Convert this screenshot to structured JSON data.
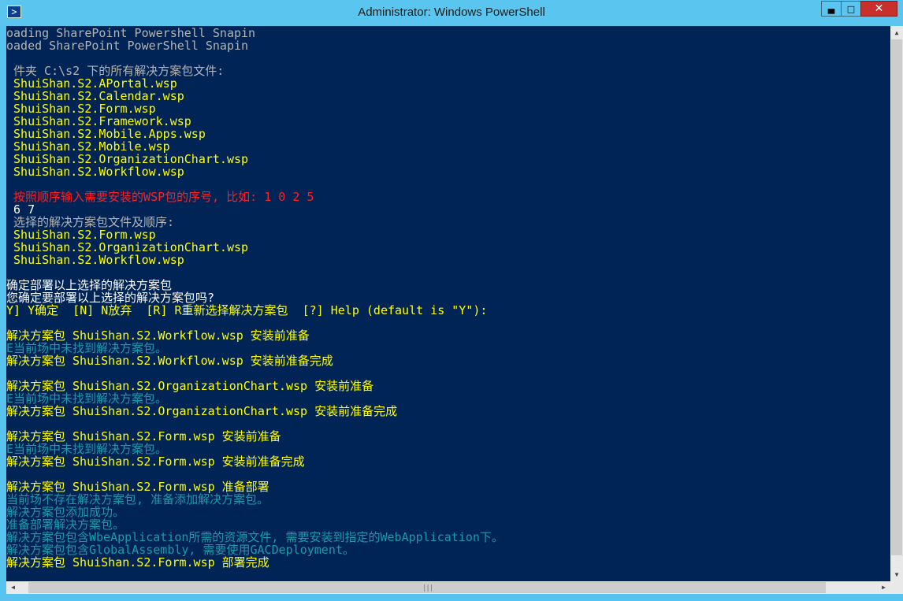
{
  "window": {
    "title": "Administrator: Windows PowerShell",
    "app_icon": "powershell-icon"
  },
  "buttons": {
    "minimize": "minimize-icon",
    "maximize": "maximize-icon",
    "close": "close-icon"
  },
  "colors": {
    "console_bg": "#012456",
    "titlebar": "#5ac6ef",
    "gray": "#b4b4b4",
    "yellow": "#ffff00",
    "red": "#ff2020",
    "white": "#ffffff",
    "cyan": "#1a9aac"
  },
  "console": {
    "lines": [
      {
        "text": "oading SharePoint Powershell Snapin",
        "color": "#b4b4b4"
      },
      {
        "text": "oaded SharePoint PowerShell Snapin",
        "color": "#b4b4b4"
      },
      {
        "text": "",
        "color": "#b4b4b4"
      },
      {
        "text": " 件夹 C:\\s2 下的所有解决方案包文件:",
        "color": "#b4b4b4"
      },
      {
        "text": " ShuiShan.S2.APortal.wsp",
        "color": "#ffff00"
      },
      {
        "text": " ShuiShan.S2.Calendar.wsp",
        "color": "#ffff00"
      },
      {
        "text": " ShuiShan.S2.Form.wsp",
        "color": "#ffff00"
      },
      {
        "text": " ShuiShan.S2.Framework.wsp",
        "color": "#ffff00"
      },
      {
        "text": " ShuiShan.S2.Mobile.Apps.wsp",
        "color": "#ffff00"
      },
      {
        "text": " ShuiShan.S2.Mobile.wsp",
        "color": "#ffff00"
      },
      {
        "text": " ShuiShan.S2.OrganizationChart.wsp",
        "color": "#ffff00"
      },
      {
        "text": " ShuiShan.S2.Workflow.wsp",
        "color": "#ffff00"
      },
      {
        "text": "",
        "color": "#b4b4b4"
      },
      {
        "text": " 按照顺序输入需要安装的WSP包的序号, 比如: 1 0 2 5",
        "color": "#ff2020"
      },
      {
        "text": " 6 7",
        "color": "#ffffff"
      },
      {
        "text": " 选择的解决方案包文件及顺序:",
        "color": "#b4b4b4"
      },
      {
        "text": " ShuiShan.S2.Form.wsp",
        "color": "#ffff00"
      },
      {
        "text": " ShuiShan.S2.OrganizationChart.wsp",
        "color": "#ffff00"
      },
      {
        "text": " ShuiShan.S2.Workflow.wsp",
        "color": "#ffff00"
      },
      {
        "text": "",
        "color": "#b4b4b4"
      },
      {
        "text": "确定部署以上选择的解决方案包",
        "color": "#ffffff"
      },
      {
        "text": "您确定要部署以上选择的解决方案包吗?",
        "color": "#ffffff"
      },
      {
        "text": "Y] Y确定  [N] N放弃  [R] R重新选择解决方案包  [?] Help (default is \"Y\"):",
        "color": "#ffff00"
      },
      {
        "text": "",
        "color": "#b4b4b4"
      },
      {
        "text": "解决方案包 ShuiShan.S2.Workflow.wsp 安装前准备",
        "color": "#ffff00"
      },
      {
        "text": "E当前场中未找到解决方案包。",
        "color": "#1a9aac"
      },
      {
        "text": "解决方案包 ShuiShan.S2.Workflow.wsp 安装前准备完成",
        "color": "#ffff00"
      },
      {
        "text": "",
        "color": "#b4b4b4"
      },
      {
        "text": "解决方案包 ShuiShan.S2.OrganizationChart.wsp 安装前准备",
        "color": "#ffff00"
      },
      {
        "text": "E当前场中未找到解决方案包。",
        "color": "#1a9aac"
      },
      {
        "text": "解决方案包 ShuiShan.S2.OrganizationChart.wsp 安装前准备完成",
        "color": "#ffff00"
      },
      {
        "text": "",
        "color": "#b4b4b4"
      },
      {
        "text": "解决方案包 ShuiShan.S2.Form.wsp 安装前准备",
        "color": "#ffff00"
      },
      {
        "text": "E当前场中未找到解决方案包。",
        "color": "#1a9aac"
      },
      {
        "text": "解决方案包 ShuiShan.S2.Form.wsp 安装前准备完成",
        "color": "#ffff00"
      },
      {
        "text": "",
        "color": "#b4b4b4"
      },
      {
        "text": "解决方案包 ShuiShan.S2.Form.wsp 准备部署",
        "color": "#ffff00"
      },
      {
        "text": "当前场不存在解决方案包, 准备添加解决方案包。",
        "color": "#1a9aac"
      },
      {
        "text": "解决方案包添加成功。",
        "color": "#1a9aac"
      },
      {
        "text": "准备部署解决方案包。",
        "color": "#1a9aac"
      },
      {
        "text": "解决方案包包含WbeApplication所需的资源文件, 需要安装到指定的WebApplication下。",
        "color": "#1a9aac"
      },
      {
        "text": "解决方案包包含GlobalAssembly, 需要使用GACDeployment。",
        "color": "#1a9aac"
      },
      {
        "text": "解决方案包 ShuiShan.S2.Form.wsp 部署完成",
        "color": "#ffff00"
      }
    ]
  }
}
